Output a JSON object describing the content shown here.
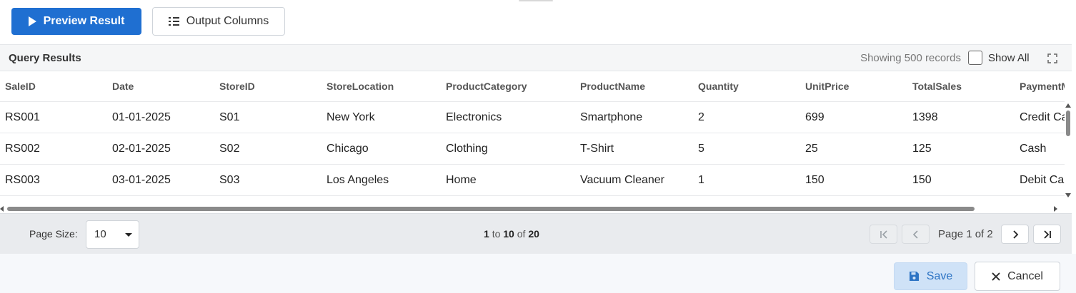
{
  "toolbar": {
    "preview_label": "Preview Result",
    "output_columns_label": "Output Columns"
  },
  "results": {
    "title": "Query Results",
    "records_text": "Showing 500 records",
    "show_all_label": "Show All"
  },
  "table": {
    "columns": [
      "SaleID",
      "Date",
      "StoreID",
      "StoreLocation",
      "ProductCategory",
      "ProductName",
      "Quantity",
      "UnitPrice",
      "TotalSales",
      "PaymentMethod"
    ],
    "rows": [
      [
        "RS001",
        "01-01-2025",
        "S01",
        "New York",
        "Electronics",
        "Smartphone",
        "2",
        "699",
        "1398",
        "Credit Card"
      ],
      [
        "RS002",
        "02-01-2025",
        "S02",
        "Chicago",
        "Clothing",
        "T-Shirt",
        "5",
        "25",
        "125",
        "Cash"
      ],
      [
        "RS003",
        "03-01-2025",
        "S03",
        "Los Angeles",
        "Home",
        "Vacuum Cleaner",
        "1",
        "150",
        "150",
        "Debit Card"
      ]
    ]
  },
  "pager": {
    "page_size_label": "Page Size:",
    "page_size_value": "10",
    "range_from": "1",
    "range_to_word": "to",
    "range_to": "10",
    "range_of_word": "of",
    "range_total": "20",
    "page_label": "Page 1 of 2"
  },
  "footer": {
    "save_label": "Save",
    "cancel_label": "Cancel"
  },
  "colors": {
    "primary": "#1f6fd1",
    "save_bg": "#cfe2f7",
    "save_text": "#2d74c4"
  }
}
